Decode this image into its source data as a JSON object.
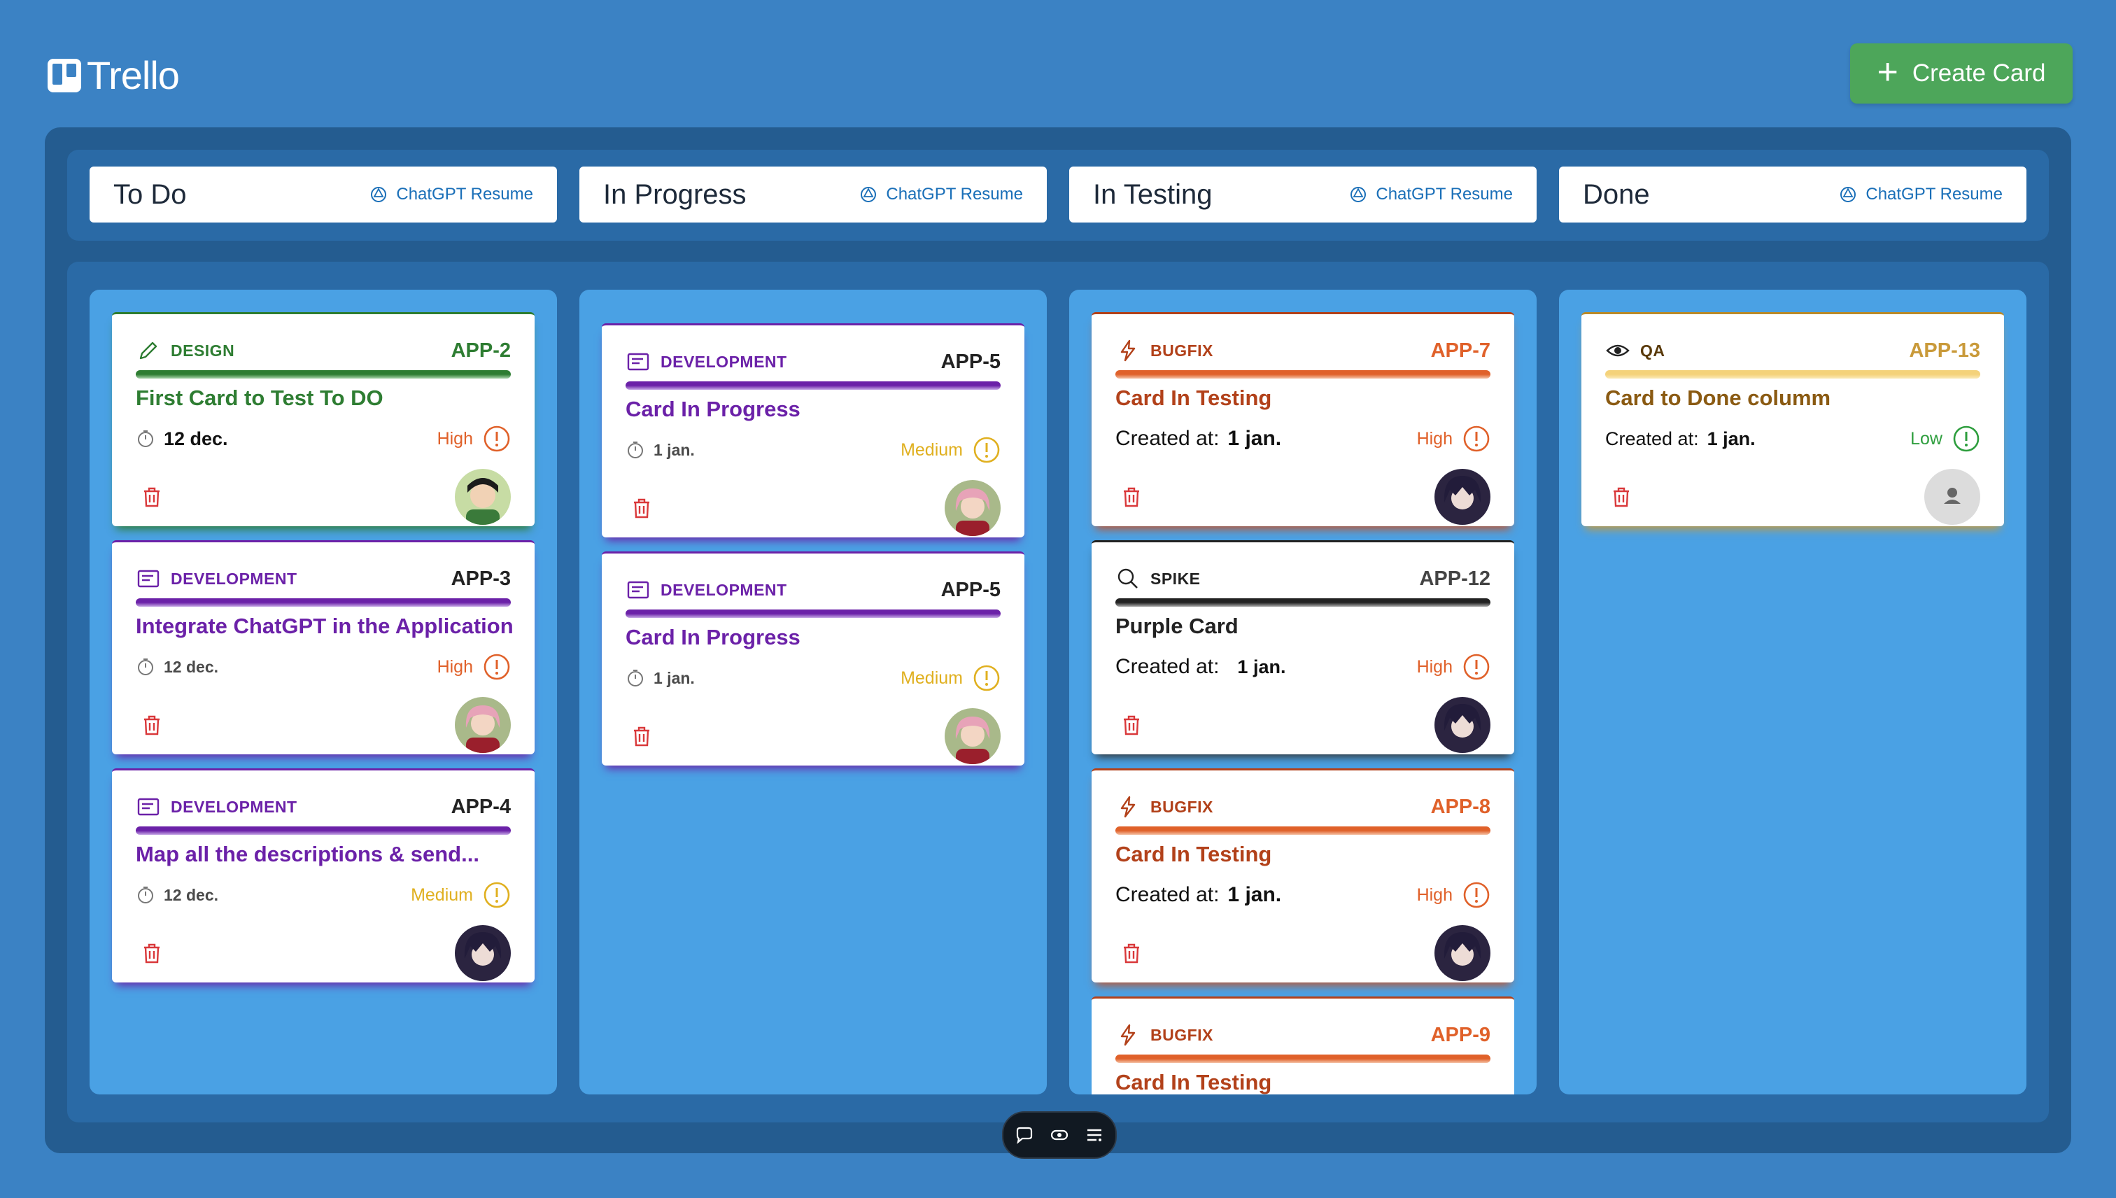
{
  "app": {
    "name": "Trello",
    "create_label": "Create Card"
  },
  "columns": [
    {
      "title": "To Do",
      "resume_label": "ChatGPT Resume"
    },
    {
      "title": "In Progress",
      "resume_label": "ChatGPT Resume"
    },
    {
      "title": "In Testing",
      "resume_label": "ChatGPT Resume"
    },
    {
      "title": "Done",
      "resume_label": "ChatGPT Resume"
    }
  ],
  "cards": {
    "todo": [
      {
        "type": "DESIGN",
        "code": "APP-2",
        "title": "First Card to Test To DO",
        "date": "12 dec.",
        "priority": "High",
        "type_color": "#2e7d32",
        "priority_color": "#e0612a"
      },
      {
        "type": "DEVELOPMENT",
        "code": "APP-3",
        "title": "Integrate ChatGPT in the Application",
        "date": "12 dec.",
        "priority": "High",
        "type_color": "#6b21a8",
        "priority_color": "#e0612a"
      },
      {
        "type": "DEVELOPMENT",
        "code": "APP-4",
        "title": "Map all the descriptions & send...",
        "date": "12 dec.",
        "priority": "Medium",
        "type_color": "#6b21a8",
        "priority_color": "#e0b020"
      }
    ],
    "progress": [
      {
        "type": "DEVELOPMENT",
        "code": "APP-5",
        "title": "Card In Progress",
        "date": "1 jan.",
        "priority": "Medium",
        "type_color": "#6b21a8",
        "priority_color": "#e0b020"
      },
      {
        "type": "DEVELOPMENT",
        "code": "APP-5",
        "title": "Card In Progress",
        "date": "1 jan.",
        "priority": "Medium",
        "type_color": "#6b21a8",
        "priority_color": "#e0b020"
      }
    ],
    "testing": [
      {
        "type": "BUGFIX",
        "code": "APP-7",
        "title": "Card In Testing",
        "created_label": "Created at:",
        "date": "1 jan.",
        "priority": "High",
        "type_color": "#b2411a",
        "priority_color": "#e0612a"
      },
      {
        "type": "SPIKE",
        "code": "APP-12",
        "title": "Purple Card",
        "created_label": "Created at:",
        "date": "1 jan.",
        "priority": "High",
        "type_color": "#222222",
        "priority_color": "#e0612a"
      },
      {
        "type": "BUGFIX",
        "code": "APP-8",
        "title": "Card In Testing",
        "created_label": "Created at:",
        "date": "1 jan.",
        "priority": "High",
        "type_color": "#b2411a",
        "priority_color": "#e0612a"
      },
      {
        "type": "BUGFIX",
        "code": "APP-9",
        "title": "Card In Testing",
        "type_color": "#b2411a"
      }
    ],
    "done": [
      {
        "type": "QA",
        "code": "APP-13",
        "title": "Card to Done columm",
        "created_label": "Created at:",
        "date": "1 jan.",
        "priority": "Low",
        "type_color": "#8a5a12",
        "priority_color": "#2e9e3e"
      }
    ]
  }
}
